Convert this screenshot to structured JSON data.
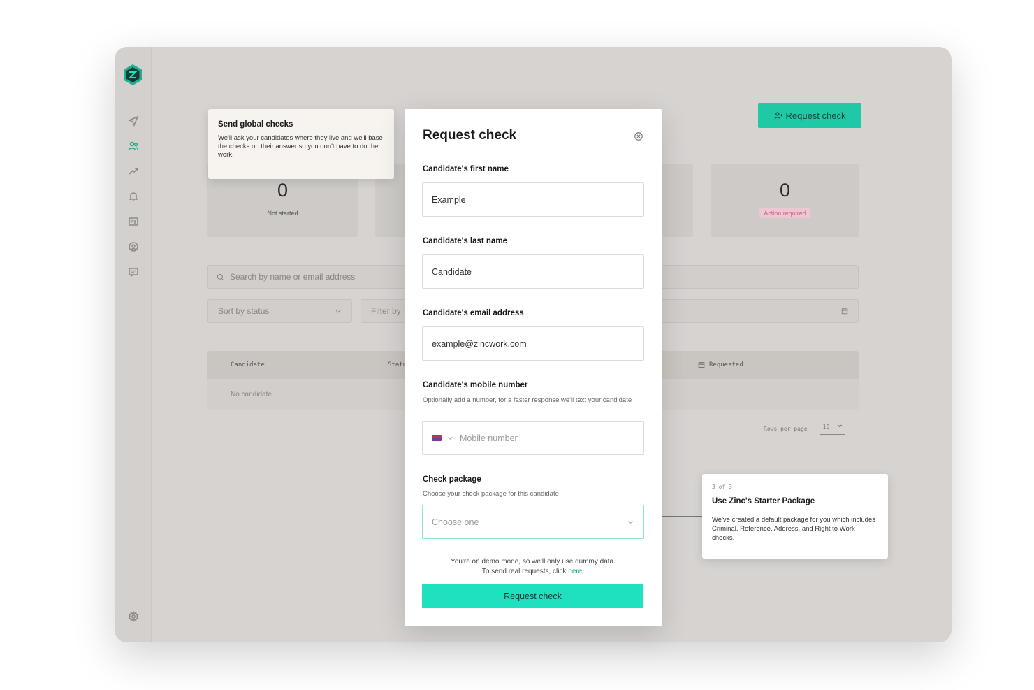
{
  "sidebar": {
    "logo_alt": "Zinc",
    "icons": [
      "send-icon",
      "candidates-icon",
      "trending-icon",
      "notifications-icon",
      "id-card-icon",
      "account-icon",
      "messages-icon",
      "settings-icon"
    ]
  },
  "header": {
    "request_check_label": "Request check"
  },
  "stats": [
    {
      "value": "0",
      "label": "Not started"
    },
    {
      "value": "0",
      "label": "Action required"
    }
  ],
  "search": {
    "placeholder": "Search by name or email address"
  },
  "filters": {
    "sort_label": "Sort by status",
    "filter_label": "Filter by"
  },
  "table": {
    "columns": [
      "Candidate",
      "Status",
      "Requested"
    ],
    "empty_text": "No candidate"
  },
  "pagination": {
    "rows_label": "Rows per page",
    "rows_value": "10"
  },
  "tooltip_global": {
    "title": "Send global checks",
    "description": "We'll ask your candidates where they live and we'll base the checks on their answer so you don't have to do the work."
  },
  "tooltip_starter": {
    "step": "3 of 3",
    "title": "Use Zinc's Starter Package",
    "description": "We've created a default package for you which includes Criminal, Reference, Address, and Right to Work checks."
  },
  "modal": {
    "title": "Request check",
    "first_name": {
      "label": "Candidate's first name",
      "value": "Example"
    },
    "last_name": {
      "label": "Candidate's last name",
      "value": "Candidate"
    },
    "email": {
      "label": "Candidate's email address",
      "value": "example@zincwork.com"
    },
    "mobile": {
      "label": "Candidate's mobile number",
      "hint": "Optionally add a number, for a faster response we'll text your candidate",
      "placeholder": "Mobile number"
    },
    "package": {
      "label": "Check package",
      "hint": "Choose your check package for this candidate",
      "placeholder": "Choose one"
    },
    "demo_note_1": "You're on demo mode, so we'll only use dummy data.",
    "demo_note_2": "To send real requests, click",
    "demo_link": "here",
    "submit_label": "Request check"
  },
  "colors": {
    "accent": "#1fe0bf",
    "accent_dark": "#20c9a6",
    "overlay_bg": "#d6d3d1",
    "pink_badge": "#d95a8b"
  }
}
